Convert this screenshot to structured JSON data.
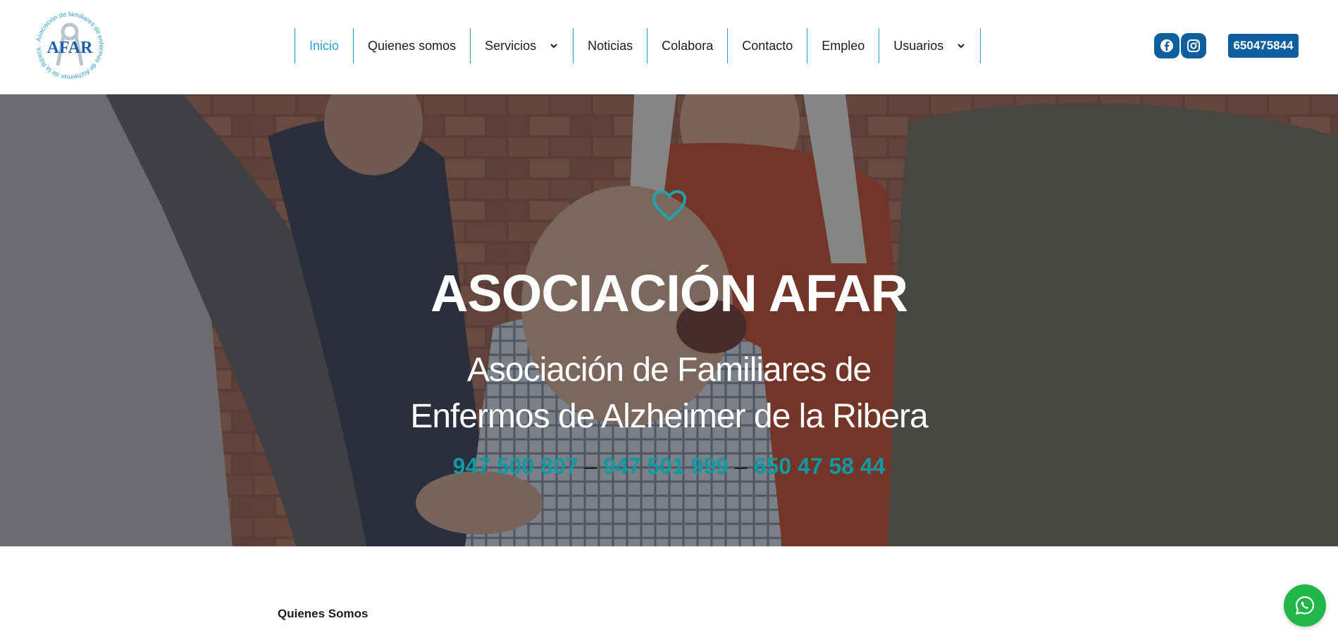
{
  "logo": {
    "text": "AFAR",
    "ring_text": "Asociación de familiares de enfermos de Alzheimer de la Ribera.",
    "color": "#2a9fd6"
  },
  "nav": {
    "items": [
      {
        "label": "Inicio",
        "active": true
      },
      {
        "label": "Quienes somos"
      },
      {
        "label": "Servicios",
        "dropdown": true
      },
      {
        "label": "Noticias"
      },
      {
        "label": "Colabora"
      },
      {
        "label": "Contacto"
      },
      {
        "label": "Empleo"
      },
      {
        "label": "Usuarios",
        "dropdown": true
      }
    ],
    "active_color": "#2a9fd6"
  },
  "social": {
    "facebook_icon": "facebook-icon",
    "instagram_icon": "instagram-icon",
    "color": "#0f5f9e"
  },
  "header_phone": "650475844",
  "hero": {
    "icon": "heart-icon",
    "title": "ASOCIACIÓN AFAR",
    "subtitle_line1": "Asociación de Familiares de",
    "subtitle_line2": "Enfermos de Alzheimer de la Ribera",
    "phone1": "947 500 807",
    "phone2": "947 501 999",
    "phone3": "650 47 58 44",
    "separator": "–",
    "phone_color": "#0f9aa3"
  },
  "section": {
    "label": "Quienes Somos"
  },
  "whatsapp": {
    "icon": "whatsapp-icon",
    "color": "#22b548"
  }
}
